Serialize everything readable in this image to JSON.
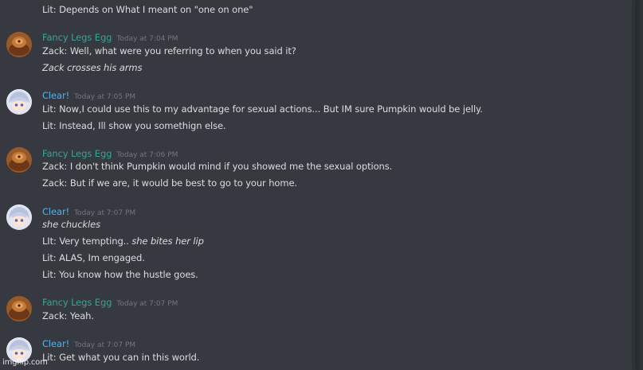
{
  "watermark": "imgflip.com",
  "colors": {
    "background": "#36393f",
    "text": "#dcddde",
    "timestamp": "#72767d",
    "egg_name": "#3aa393",
    "clear_name": "#5ab0e6"
  },
  "messages": {
    "m0": {
      "lines": [
        "Lit: Depends on What I meant on \"one on one\""
      ]
    },
    "m1": {
      "author": "Fancy Legs Egg",
      "timestamp": "Today at 7:04 PM",
      "lines": [
        "Zack: Well, what were you referring to when you said it?",
        "Zack crosses his arms"
      ]
    },
    "m2": {
      "author": "Clear!",
      "timestamp": "Today at 7:05 PM",
      "lines": [
        "Lit: Now,I could use this to my advantage for sexual actions... But IM sure Pumpkin would be jelly.",
        "Lit: Instead, Ill show you somethign else."
      ]
    },
    "m3": {
      "author": "Fancy Legs Egg",
      "timestamp": "Today at 7:06 PM",
      "lines": [
        "Zack: I don't think Pumpkin would mind if you showed me the sexual options.",
        "Zack: But if we are, it would be best to go to your home."
      ]
    },
    "m4": {
      "author": "Clear!",
      "timestamp": "Today at 7:07 PM",
      "lines": [
        "she chuckles",
        "LIt: Very tempting.. ",
        "she bites her lip",
        "Lit: ALAS, Im engaged.",
        "Lit: You know how the hustle goes."
      ]
    },
    "m5": {
      "author": "Fancy Legs Egg",
      "timestamp": "Today at 7:07 PM",
      "lines": [
        "Zack: Yeah."
      ]
    },
    "m6": {
      "author": "Clear!",
      "timestamp": "Today at 7:07 PM",
      "lines": [
        "Lit: Get what you can in this world."
      ]
    }
  }
}
